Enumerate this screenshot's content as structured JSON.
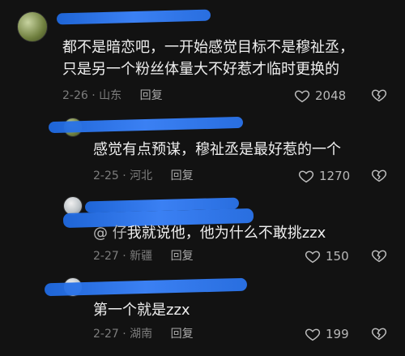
{
  "comments": [
    {
      "text_lines": [
        "都不是暗恋吧，一开始感觉目标不是穆祉丞，",
        "只是另一个粉丝体量大不好惹才临时更换的"
      ],
      "date": "2-26",
      "location": "山东",
      "reply_label": "回复",
      "likes": "2048",
      "icon": "heart-outline-icon",
      "dislike_icon": "broken-heart-icon"
    },
    {
      "text_lines": [
        "感觉有点预谋，穆祉丞是最好惹的一个"
      ],
      "date": "2-25",
      "location": "河北",
      "reply_label": "回复",
      "likes": "1270",
      "icon": "heart-outline-icon",
      "dislike_icon": "broken-heart-icon"
    },
    {
      "text_lines": [
        "我就说他，他为什么不敢挑zzx"
      ],
      "text_prefix": "@ 仔",
      "date": "2-27",
      "location": "新疆",
      "reply_label": "回复",
      "likes": "150",
      "icon": "heart-outline-icon",
      "dislike_icon": "broken-heart-icon"
    },
    {
      "text_lines": [
        "第一个就是zzx"
      ],
      "date": "2-27",
      "location": "湖南",
      "reply_label": "回复",
      "likes": "199",
      "icon": "heart-outline-icon",
      "dislike_icon": "broken-heart-icon"
    }
  ],
  "colors": {
    "background": "#121212",
    "text": "#eeeeee",
    "meta": "#7d7d7d",
    "redaction": "#2a73ea"
  }
}
